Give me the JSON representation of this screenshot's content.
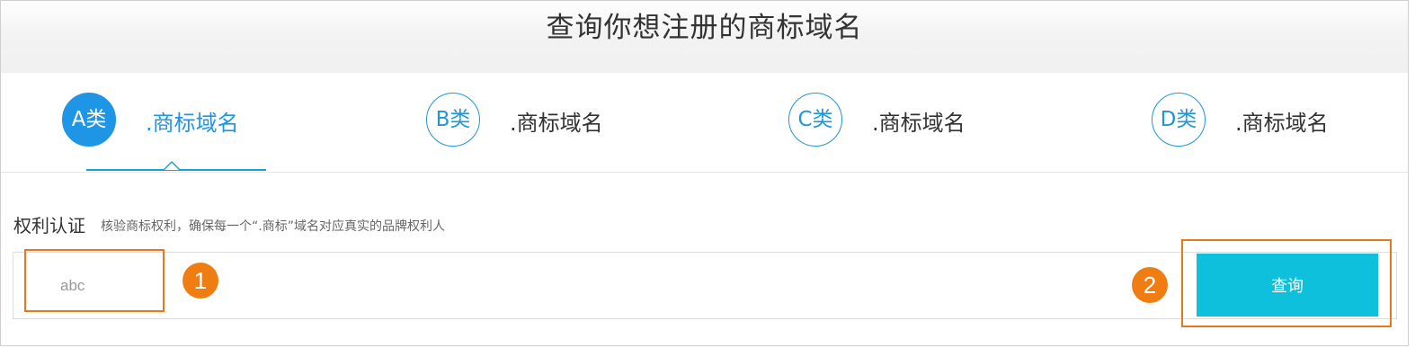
{
  "header": {
    "title": "查询你想注册的商标域名"
  },
  "tabs": [
    {
      "badge": "A类",
      "label": ".商标域名",
      "active": true
    },
    {
      "badge": "B类",
      "label": ".商标域名",
      "active": false
    },
    {
      "badge": "C类",
      "label": ".商标域名",
      "active": false
    },
    {
      "badge": "D类",
      "label": ".商标域名",
      "active": false
    }
  ],
  "rights": {
    "title": "权利认证",
    "description": "核验商标权利，确保每一个“.商标”域名对应真实的品牌权利人"
  },
  "search": {
    "value": "abc",
    "button_label": "查询"
  },
  "markers": {
    "step1": "1",
    "step2": "2"
  },
  "colors": {
    "accent_blue": "#1f95e6",
    "button_cyan": "#0ec0dc",
    "annotation_orange": "#e8781e"
  }
}
